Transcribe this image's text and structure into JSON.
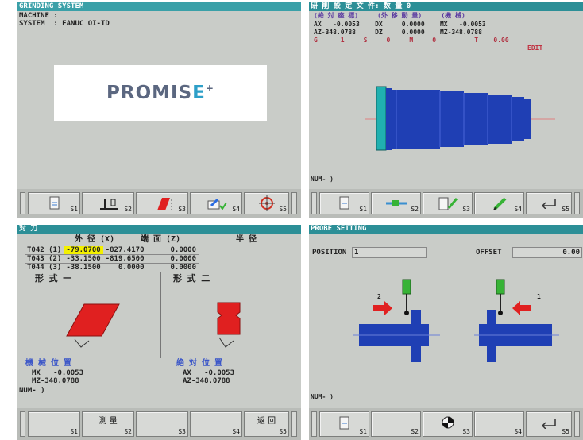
{
  "panel1": {
    "title": "GRINDING SYSTEM",
    "line1": "MACHINE :",
    "line2": "SYSTEM  : FANUC OI-TD",
    "logo_text": "PROMIS",
    "logo_mark": "E",
    "logo_sup": "+",
    "softkeys": [
      "S1",
      "S2",
      "S3",
      "S4",
      "S5"
    ],
    "softkey_icons": [
      "document-icon",
      "measure-axes-icon",
      "red-parallelogram-icon",
      "edit-check-icon",
      "target-icon"
    ]
  },
  "panel2": {
    "title": "研 削 設 定        文 件:            数 量        0",
    "row_headers": "(絶 対 座 標)     (外 移 動 量)     (機 械)",
    "row1": "AX   -0.0053    DX     0.0000    MX   -0.0053",
    "row2": "AZ-348.0788     DZ     0.0000    MZ-348.0788",
    "row3": "G      1     S     0     M     0          T    0.00",
    "mode": "EDIT",
    "num": "NUM- )",
    "softkeys": [
      "S1",
      "S2",
      "S3",
      "S4",
      "S5"
    ],
    "softkey_icons": [
      "document-icon",
      "probe-arrow-icon",
      "document-pencil-icon",
      "pencil-icon",
      "return-icon"
    ]
  },
  "panel3": {
    "title": "对 刀",
    "col_headers": [
      "外 径 (X)",
      "端 面 (Z)",
      "半 径"
    ],
    "rows": [
      [
        "T042 (1)",
        "-79.0700",
        "-827.4170",
        "0.0000"
      ],
      [
        "T043 (2)",
        "-33.1500",
        "-819.6500",
        "0.0000"
      ],
      [
        "T044 (3)",
        "-38.1500",
        "0.0000",
        "0.0000"
      ]
    ],
    "form1": "形 式 一",
    "form2": "形 式 二",
    "mech_label": "機 械 位 置",
    "mech_x": "MX   -0.0053",
    "mech_z": "MZ-348.0788",
    "abs_label": "絶 対 位 置",
    "abs_x": "AX   -0.0053",
    "abs_z": "AZ-348.0788",
    "num": "NUM- )",
    "softkeys": [
      "S1",
      "S2",
      "S3",
      "S4",
      "S5"
    ],
    "softkey_texts": [
      "",
      "測 量",
      "",
      "",
      "返 回"
    ]
  },
  "panel4": {
    "title": "PROBE SETTING",
    "position_label": "POSITION",
    "position_value": "1",
    "offset_label": "OFFSET",
    "offset_value": "0.00",
    "arrow1": "1",
    "arrow2": "2",
    "num": "NUM- )",
    "softkeys": [
      "S1",
      "S2",
      "S3",
      "S4",
      "S5"
    ],
    "softkey_icons": [
      "document-icon",
      "",
      "target-quadrant-icon",
      "",
      "return-icon"
    ]
  },
  "colors": {
    "title_bar": "#3aa0a8",
    "screen_bg": "#c9ccc8",
    "part_blue": "#1f3fb4",
    "part_cyan": "#20b0b0",
    "red": "#e02020",
    "green": "#37b336",
    "highlight": "#f3f000"
  }
}
